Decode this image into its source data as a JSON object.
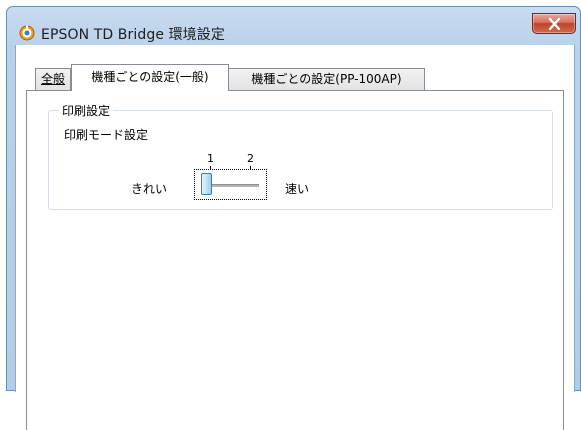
{
  "window": {
    "title": "EPSON TD Bridge 環境設定",
    "icon": "epson-app-icon",
    "close_icon": "close-icon"
  },
  "tabs": [
    {
      "label": "全般",
      "active": false
    },
    {
      "label": "機種ごとの設定(一般)",
      "active": true
    },
    {
      "label": "機種ごとの設定(PP-100AP)",
      "active": false
    }
  ],
  "print_settings": {
    "group_title": "印刷設定",
    "mode_label": "印刷モード設定",
    "slider": {
      "min_label": "きれい",
      "max_label": "速い",
      "tick_labels": [
        "1",
        "2"
      ],
      "value": 1
    }
  },
  "colors": {
    "title_bar": "#b9d1ea",
    "close_button": "#c0432a",
    "tab_border": "#898c95"
  }
}
